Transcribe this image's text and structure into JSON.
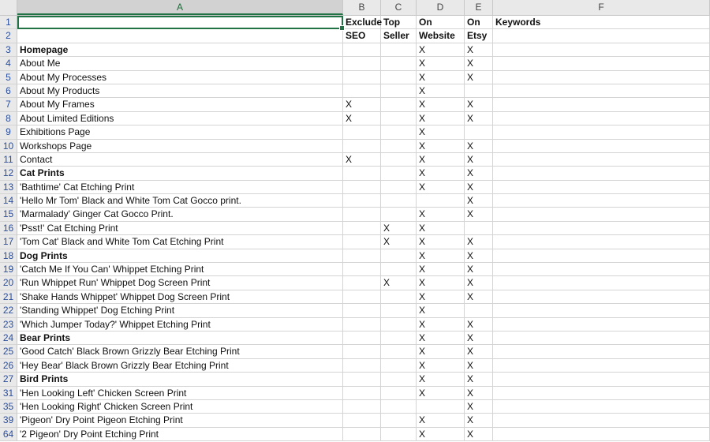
{
  "columns": [
    "A",
    "B",
    "C",
    "D",
    "E",
    "F"
  ],
  "header_row1": {
    "num": "1",
    "a": "",
    "b": "Exclude",
    "c": "Top",
    "d": "On",
    "e": "On",
    "f": "Keywords"
  },
  "header_row2": {
    "num": "2",
    "a": "",
    "b": "SEO",
    "c": "Seller",
    "d": "Website",
    "e": "Etsy",
    "f": ""
  },
  "rows": [
    {
      "num": "3",
      "a": "Homepage",
      "bold": true,
      "b": "",
      "c": "",
      "d": "X",
      "e": "X"
    },
    {
      "num": "4",
      "a": "About Me",
      "bold": false,
      "b": "",
      "c": "",
      "d": "X",
      "e": "X"
    },
    {
      "num": "5",
      "a": "About My Processes",
      "bold": false,
      "b": "",
      "c": "",
      "d": "X",
      "e": "X"
    },
    {
      "num": "6",
      "a": "About My Products",
      "bold": false,
      "b": "",
      "c": "",
      "d": "X",
      "e": ""
    },
    {
      "num": "7",
      "a": "About My Frames",
      "bold": false,
      "b": "X",
      "c": "",
      "d": "X",
      "e": "X"
    },
    {
      "num": "8",
      "a": "About Limited Editions",
      "bold": false,
      "b": "X",
      "c": "",
      "d": "X",
      "e": "X"
    },
    {
      "num": "9",
      "a": "Exhibitions Page",
      "bold": false,
      "b": "",
      "c": "",
      "d": "X",
      "e": ""
    },
    {
      "num": "10",
      "a": "Workshops Page",
      "bold": false,
      "b": "",
      "c": "",
      "d": "X",
      "e": "X"
    },
    {
      "num": "11",
      "a": "Contact",
      "bold": false,
      "b": "X",
      "c": "",
      "d": "X",
      "e": "X"
    },
    {
      "num": "12",
      "a": "Cat Prints",
      "bold": true,
      "b": "",
      "c": "",
      "d": "X",
      "e": "X"
    },
    {
      "num": "13",
      "a": "'Bathtime' Cat Etching Print",
      "bold": false,
      "b": "",
      "c": "",
      "d": "X",
      "e": "X"
    },
    {
      "num": "14",
      "a": "'Hello Mr Tom' Black and White Tom Cat Gocco print.",
      "bold": false,
      "b": "",
      "c": "",
      "d": "",
      "e": "X"
    },
    {
      "num": "15",
      "a": "'Marmalady' Ginger Cat Gocco Print.",
      "bold": false,
      "b": "",
      "c": "",
      "d": "X",
      "e": "X"
    },
    {
      "num": "16",
      "a": "'Psst!' Cat Etching Print",
      "bold": false,
      "b": "",
      "c": "X",
      "d": "X",
      "e": ""
    },
    {
      "num": "17",
      "a": "'Tom Cat' Black and White Tom Cat Etching Print",
      "bold": false,
      "b": "",
      "c": "X",
      "d": "X",
      "e": "X"
    },
    {
      "num": "18",
      "a": "Dog Prints",
      "bold": true,
      "b": "",
      "c": "",
      "d": "X",
      "e": "X"
    },
    {
      "num": "19",
      "a": "'Catch Me If You Can' Whippet Etching Print",
      "bold": false,
      "b": "",
      "c": "",
      "d": "X",
      "e": "X"
    },
    {
      "num": "20",
      "a": "'Run Whippet Run' Whippet Dog Screen Print",
      "bold": false,
      "b": "",
      "c": "X",
      "d": "X",
      "e": "X"
    },
    {
      "num": "21",
      "a": "'Shake Hands Whippet' Whippet Dog Screen Print",
      "bold": false,
      "b": "",
      "c": "",
      "d": "X",
      "e": "X"
    },
    {
      "num": "22",
      "a": "'Standing Whippet' Dog Etching Print",
      "bold": false,
      "b": "",
      "c": "",
      "d": "X",
      "e": ""
    },
    {
      "num": "23",
      "a": "'Which Jumper Today?' Whippet Etching Print",
      "bold": false,
      "b": "",
      "c": "",
      "d": "X",
      "e": "X"
    },
    {
      "num": "24",
      "a": "Bear Prints",
      "bold": true,
      "b": "",
      "c": "",
      "d": "X",
      "e": "X"
    },
    {
      "num": "25",
      "a": "'Good Catch' Black Brown Grizzly Bear Etching Print",
      "bold": false,
      "b": "",
      "c": "",
      "d": "X",
      "e": "X"
    },
    {
      "num": "26",
      "a": "'Hey Bear' Black Brown Grizzly Bear Etching Print",
      "bold": false,
      "b": "",
      "c": "",
      "d": "X",
      "e": "X"
    },
    {
      "num": "27",
      "a": "Bird Prints",
      "bold": true,
      "b": "",
      "c": "",
      "d": "X",
      "e": "X"
    },
    {
      "num": "31",
      "a": "'Hen Looking Left' Chicken Screen Print",
      "bold": false,
      "b": "",
      "c": "",
      "d": "X",
      "e": "X"
    },
    {
      "num": "35",
      "a": "'Hen Looking Right' Chicken Screen Print",
      "bold": false,
      "b": "",
      "c": "",
      "d": "",
      "e": "X"
    },
    {
      "num": "39",
      "a": "'Pigeon' Dry Point Pigeon Etching Print",
      "bold": false,
      "b": "",
      "c": "",
      "d": "X",
      "e": "X"
    },
    {
      "num": "64",
      "a": "'2 Pigeon' Dry Point Etching Print",
      "bold": false,
      "b": "",
      "c": "",
      "d": "X",
      "e": "X"
    }
  ]
}
